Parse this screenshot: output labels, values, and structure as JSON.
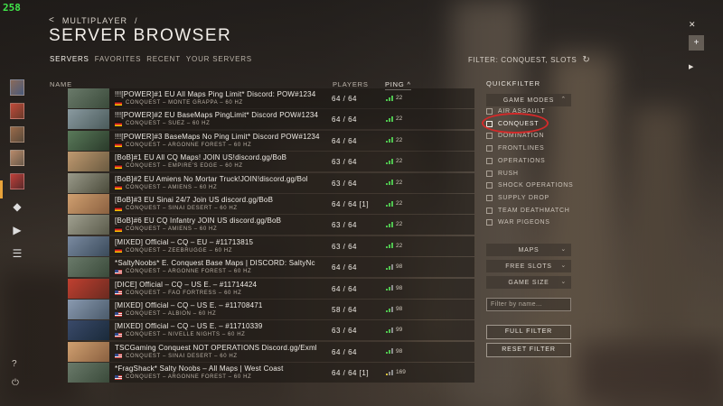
{
  "overlay": {
    "fps": "258"
  },
  "breadcrumb": {
    "back": "<",
    "section": "MULTIPLAYER",
    "separator": "/"
  },
  "page": {
    "title": "SERVER BROWSER"
  },
  "tabs": [
    {
      "label": "SERVERS",
      "active": true
    },
    {
      "label": "FAVORITES",
      "active": false
    },
    {
      "label": "RECENT",
      "active": false
    },
    {
      "label": "YOUR SERVERS",
      "active": false
    }
  ],
  "active_filter": {
    "label": "FILTER: CONQUEST, SLOTS",
    "refresh_icon": "refresh-icon"
  },
  "columns": {
    "name": "NAME",
    "players": "PLAYERS",
    "ping": "PING",
    "ping_sort": "^"
  },
  "servers": [
    {
      "name": "!!![POWER]#1 EU All Maps Ping Limit* Discord: POW#1234",
      "flag": "de",
      "details": "CONQUEST – MONTE GRAPPA – 60 HZ",
      "players": "64 / 64",
      "ping": "22",
      "signal": "strong"
    },
    {
      "name": "!!![POWER]#2 EU BaseMaps PingLimit* Discord POW#1234",
      "flag": "de",
      "details": "CONQUEST – SUEZ – 60 HZ",
      "players": "64 / 64",
      "ping": "22",
      "signal": "strong"
    },
    {
      "name": "!!![POWER]#3 BaseMaps No Ping Limit* Discord POW#1234",
      "flag": "de",
      "details": "CONQUEST – ARGONNE FOREST – 60 HZ",
      "players": "64 / 64",
      "ping": "22",
      "signal": "strong"
    },
    {
      "name": "[BoB]#1 EU All CQ Maps! JOIN US!discord.gg/BoB",
      "flag": "de",
      "details": "CONQUEST – EMPIRE'S EDGE – 60 HZ",
      "players": "63 / 64",
      "ping": "22",
      "signal": "strong"
    },
    {
      "name": "[BoB]#2 EU Amiens No Mortar Truck!JOIN!discord.gg/Bol",
      "flag": "de",
      "details": "CONQUEST – AMIENS – 60 HZ",
      "players": "63 / 64",
      "ping": "22",
      "signal": "strong"
    },
    {
      "name": "[BoB]#3 EU Sinai 24/7 Join US discord.gg/BoB",
      "flag": "de",
      "details": "CONQUEST – SINAI DESERT – 60 HZ",
      "players": "64 / 64 [1]",
      "ping": "22",
      "signal": "strong"
    },
    {
      "name": "[BoB]#6 EU CQ Infantry JOIN US discord.gg/BoB",
      "flag": "de",
      "details": "CONQUEST – AMIENS – 60 HZ",
      "players": "63 / 64",
      "ping": "22",
      "signal": "strong"
    },
    {
      "name": "[MIXED] Official – CQ – EU – #11713815",
      "flag": "de",
      "details": "CONQUEST – ZEEBRUGGE – 60 HZ",
      "players": "63 / 64",
      "ping": "22",
      "signal": "strong"
    },
    {
      "name": "*SaltyNoobs* E. Conquest Base Maps | DISCORD: SaltyNc",
      "flag": "us",
      "details": "CONQUEST – ARGONNE FOREST – 60 HZ",
      "players": "64 / 64",
      "ping": "98",
      "signal": "mid"
    },
    {
      "name": "[DICE] Official – CQ – US E. – #11714424",
      "flag": "us",
      "details": "CONQUEST – FAO FORTRESS – 60 HZ",
      "players": "64 / 64",
      "ping": "98",
      "signal": "mid"
    },
    {
      "name": "[MIXED] Official – CQ – US E. – #11708471",
      "flag": "us",
      "details": "CONQUEST – ALBION – 60 HZ",
      "players": "58 / 64",
      "ping": "98",
      "signal": "mid"
    },
    {
      "name": "[MIXED] Official – CQ – US E. – #11710339",
      "flag": "us",
      "details": "CONQUEST – NIVELLE NIGHTS – 60 HZ",
      "players": "63 / 64",
      "ping": "99",
      "signal": "mid"
    },
    {
      "name": "TSCGaming Conquest NOT OPERATIONS Discord.gg/Exml",
      "flag": "us",
      "details": "CONQUEST – SINAI DESERT – 60 HZ",
      "players": "64 / 64",
      "ping": "98",
      "signal": "mid"
    },
    {
      "name": "*FragShack* Salty Noobs – All Maps | West Coast",
      "flag": "us",
      "details": "CONQUEST – ARGONNE FOREST – 60 HZ",
      "players": "64 / 64 [1]",
      "ping": "169",
      "signal": "weak"
    }
  ],
  "quickfilter": {
    "title": "QUICKFILTER",
    "game_modes_label": "GAME MODES",
    "modes": [
      {
        "label": "AIR ASSAULT",
        "checked": false
      },
      {
        "label": "CONQUEST",
        "checked": true
      },
      {
        "label": "DOMINATION",
        "checked": false
      },
      {
        "label": "FRONTLINES",
        "checked": false
      },
      {
        "label": "OPERATIONS",
        "checked": false
      },
      {
        "label": "RUSH",
        "checked": false
      },
      {
        "label": "SHOCK OPERATIONS",
        "checked": false
      },
      {
        "label": "SUPPLY DROP",
        "checked": false
      },
      {
        "label": "TEAM DEATHMATCH",
        "checked": false
      },
      {
        "label": "WAR PIGEONS",
        "checked": false
      }
    ],
    "maps_label": "MAPS",
    "free_slots_label": "FREE SLOTS",
    "game_size_label": "GAME SIZE",
    "filter_placeholder": "Filter by name...",
    "full_filter_label": "FULL FILTER",
    "reset_filter_label": "RESET FILTER"
  },
  "colors": {
    "accent_selected": "#e8a33a",
    "highlight_circle": "#d22a2a",
    "ping_good": "#4fc44f",
    "ping_weak": "#d9c23c"
  }
}
